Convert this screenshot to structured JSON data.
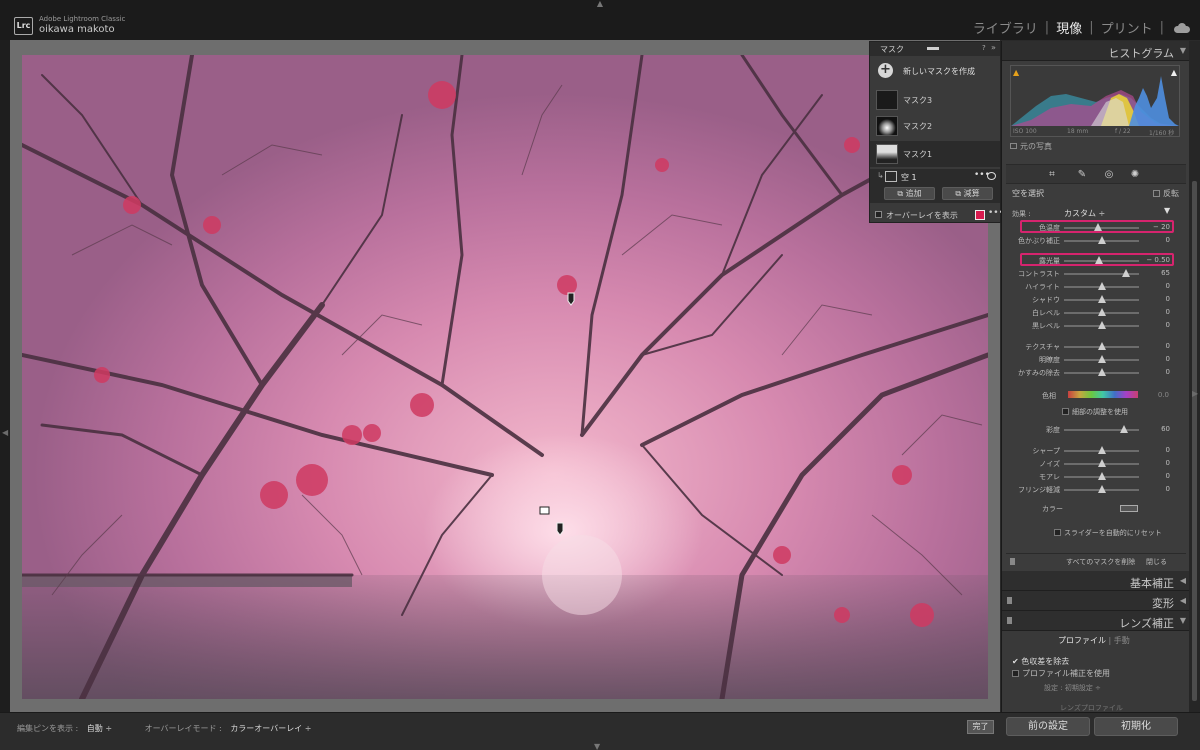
{
  "app": {
    "name": "Adobe Lightroom Classic",
    "logo": "Lrc",
    "user": "oikawa makoto"
  },
  "modules": {
    "library": "ライブラリ",
    "develop": "現像",
    "print": "プリント",
    "sep": "|"
  },
  "mask_panel": {
    "title": "マスク",
    "help": "?",
    "expand": "»",
    "new_mask_label": "新しいマスクを作成",
    "masks": [
      {
        "name": "マスク3"
      },
      {
        "name": "マスク2"
      },
      {
        "name": "マスク1"
      }
    ],
    "component": "空 1",
    "more": "•••",
    "add_label": "追加",
    "subtract_label": "減算",
    "overlay_label": "オーバーレイを表示",
    "overlay_color": "#d81b4f"
  },
  "histogram": {
    "title": "ヒストグラム",
    "iso": "ISO 100",
    "focal": "18 mm",
    "aperture": "f / 22",
    "shutter": "1/160 秒",
    "original_label": "元の写真"
  },
  "adjust": {
    "mask_name": "空を選択",
    "invert_label": "反転",
    "effect_label": "効果 :",
    "effect_preset": "カスタム ÷",
    "sliders": [
      {
        "label": "色温度",
        "value": "− 20",
        "pos": 0.45
      },
      {
        "label": "色かぶり補正",
        "value": "0",
        "pos": 0.5
      },
      {
        "label": "露光量",
        "value": "− 0.50",
        "pos": 0.47
      },
      {
        "label": "コントラスト",
        "value": "65",
        "pos": 0.82
      },
      {
        "label": "ハイライト",
        "value": "0",
        "pos": 0.5
      },
      {
        "label": "シャドウ",
        "value": "0",
        "pos": 0.5
      },
      {
        "label": "白レベル",
        "value": "0",
        "pos": 0.5
      },
      {
        "label": "黒レベル",
        "value": "0",
        "pos": 0.5
      },
      {
        "label": "テクスチャ",
        "value": "0",
        "pos": 0.5
      },
      {
        "label": "明瞭度",
        "value": "0",
        "pos": 0.5
      },
      {
        "label": "かすみの除去",
        "value": "0",
        "pos": 0.5
      },
      {
        "label": "彩度",
        "value": "60",
        "pos": 0.8
      },
      {
        "label": "シャープ",
        "value": "0",
        "pos": 0.5
      },
      {
        "label": "ノイズ",
        "value": "0",
        "pos": 0.5
      },
      {
        "label": "モアレ",
        "value": "0",
        "pos": 0.5
      },
      {
        "label": "フリンジ軽減",
        "value": "0",
        "pos": 0.5
      }
    ],
    "hue_label": "色相",
    "hue_value": "0.0",
    "fine_adjust_label": "細部の調整を使用",
    "color_label": "カラー",
    "auto_reset_label": "スライダーを自動的にリセット",
    "delete_all_label": "すべてのマスクを削除",
    "close_label": "閉じる"
  },
  "sections": {
    "basic": "基本補正",
    "transform": "変形",
    "lens": "レンズ補正"
  },
  "lens": {
    "tab_profile": "プロファイル",
    "tab_manual": "手動",
    "remove_ca_label": "色収差を除去",
    "profile_correction_label": "プロファイル補正を使用",
    "setting_label": "設定 :",
    "setting_value": "初期設定 ÷",
    "lens_profile_label": "レンズプロファイル"
  },
  "toolbar": {
    "pin_label": "編集ピンを表示 :",
    "pin_value": "自動 ÷",
    "overlay_mode_label": "オーバーレイモード :",
    "overlay_mode_value": "カラーオーバーレイ ÷",
    "done_label": "完了",
    "previous_label": "前の設定",
    "reset_label": "初期化"
  }
}
